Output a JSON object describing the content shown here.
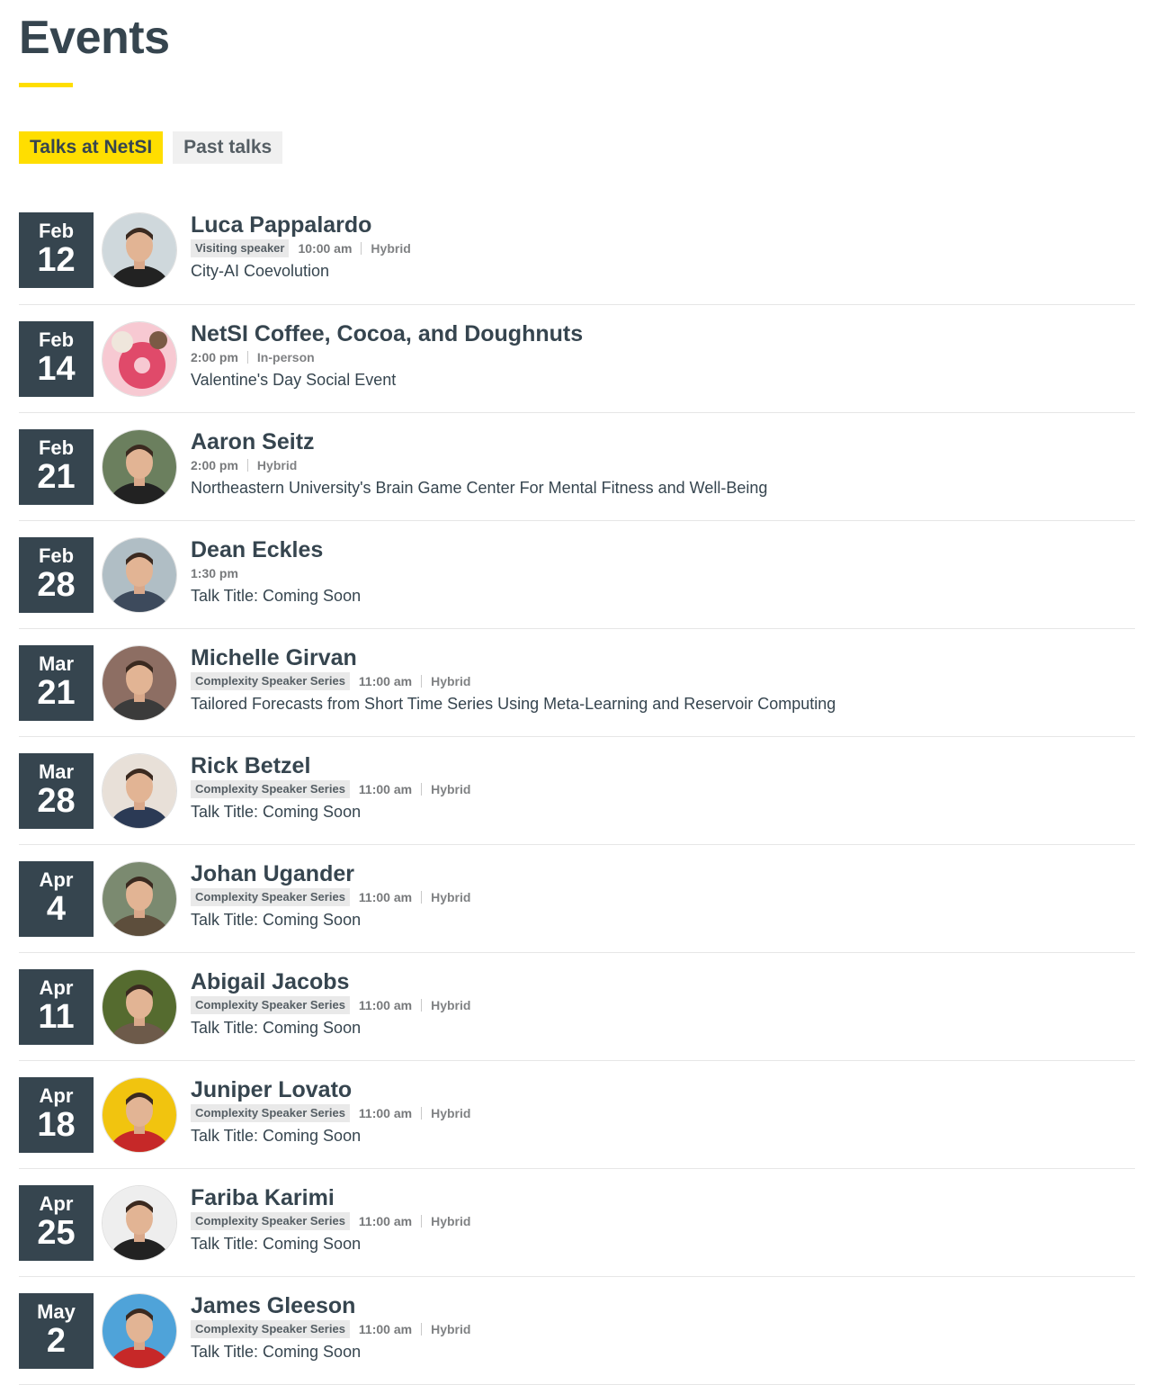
{
  "page": {
    "title": "Events"
  },
  "tabs": [
    {
      "label": "Talks at NetSI",
      "active": true
    },
    {
      "label": "Past talks",
      "active": false
    }
  ],
  "colors": {
    "accent": "#ffde00",
    "dark": "#36454f"
  },
  "events": [
    {
      "month": "Feb",
      "day": "12",
      "name": "Luca Pappalardo",
      "badge": "Visiting speaker",
      "time": "10:00 am",
      "mode": "Hybrid",
      "subtitle": "City-AI Coevolution",
      "avatar": "speaker-photo"
    },
    {
      "month": "Feb",
      "day": "14",
      "name": "NetSI Coffee, Cocoa, and Doughnuts",
      "badge": "",
      "time": "2:00 pm",
      "mode": "In-person",
      "subtitle": "Valentine's Day Social Event",
      "avatar": "doughnut-photo"
    },
    {
      "month": "Feb",
      "day": "21",
      "name": "Aaron Seitz",
      "badge": "",
      "time": "2:00 pm",
      "mode": "Hybrid",
      "subtitle": "Northeastern University's Brain Game Center For Mental Fitness and Well-Being",
      "avatar": "speaker-photo"
    },
    {
      "month": "Feb",
      "day": "28",
      "name": "Dean Eckles",
      "badge": "",
      "time": "1:30 pm",
      "mode": "",
      "subtitle": "Talk Title: Coming Soon",
      "avatar": "speaker-photo"
    },
    {
      "month": "Mar",
      "day": "21",
      "name": "Michelle Girvan",
      "badge": "Complexity Speaker Series",
      "time": "11:00 am",
      "mode": "Hybrid",
      "subtitle": "Tailored Forecasts from Short Time Series Using Meta-Learning and Reservoir Computing",
      "avatar": "speaker-photo"
    },
    {
      "month": "Mar",
      "day": "28",
      "name": "Rick Betzel",
      "badge": "Complexity Speaker Series",
      "time": "11:00 am",
      "mode": "Hybrid",
      "subtitle": "Talk Title: Coming Soon",
      "avatar": "speaker-photo"
    },
    {
      "month": "Apr",
      "day": "4",
      "name": "Johan Ugander",
      "badge": "Complexity Speaker Series",
      "time": "11:00 am",
      "mode": "Hybrid",
      "subtitle": "Talk Title: Coming Soon",
      "avatar": "speaker-photo"
    },
    {
      "month": "Apr",
      "day": "11",
      "name": "Abigail Jacobs",
      "badge": "Complexity Speaker Series",
      "time": "11:00 am",
      "mode": "Hybrid",
      "subtitle": "Talk Title: Coming Soon",
      "avatar": "speaker-photo"
    },
    {
      "month": "Apr",
      "day": "18",
      "name": "Juniper Lovato",
      "badge": "Complexity Speaker Series",
      "time": "11:00 am",
      "mode": "Hybrid",
      "subtitle": "Talk Title: Coming Soon",
      "avatar": "speaker-photo"
    },
    {
      "month": "Apr",
      "day": "25",
      "name": "Fariba Karimi",
      "badge": "Complexity Speaker Series",
      "time": "11:00 am",
      "mode": "Hybrid",
      "subtitle": "Talk Title: Coming Soon",
      "avatar": "speaker-photo"
    },
    {
      "month": "May",
      "day": "2",
      "name": "James Gleeson",
      "badge": "Complexity Speaker Series",
      "time": "11:00 am",
      "mode": "Hybrid",
      "subtitle": "Talk Title: Coming Soon",
      "avatar": "speaker-photo"
    }
  ]
}
